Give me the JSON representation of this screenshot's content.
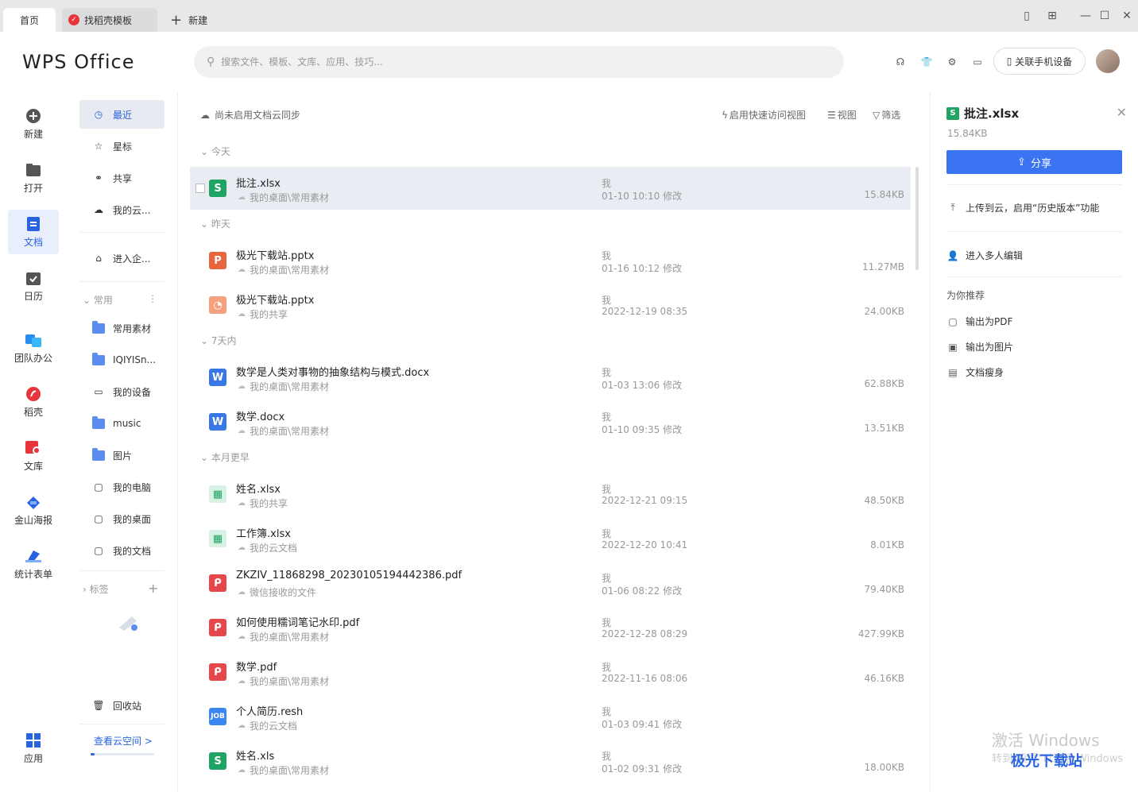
{
  "tabs": {
    "home": "首页",
    "template": "找稻壳模板",
    "new": "新建"
  },
  "header": {
    "logo": "WPS Office",
    "search_placeholder": "搜索文件、模板、文库、应用、技巧...",
    "phone_button": "关联手机设备"
  },
  "leftnav": {
    "new": "新建",
    "open": "打开",
    "docs": "文档",
    "calendar": "日历",
    "team": "团队办公",
    "daoke": "稻壳",
    "library": "文库",
    "poster": "金山海报",
    "forms": "统计表单",
    "apps": "应用"
  },
  "sidebar": {
    "recent": "最近",
    "star": "星标",
    "shared": "共享",
    "mycloud": "我的云...",
    "enterprise": "进入企...",
    "common_section": "常用",
    "items": [
      "常用素材",
      "IQIYISn...",
      "我的设备",
      "music",
      "图片",
      "我的电脑",
      "我的桌面",
      "我的文档"
    ],
    "tags_section": "标签",
    "recycle": "回收站",
    "cloud_link": "查看云空间 >",
    "cloud_usage": 0.06
  },
  "toolbar": {
    "sync_status": "尚未启用文档云同步",
    "quick_view": "启用快速访问视图",
    "view": "视图",
    "filter": "筛选"
  },
  "groups": {
    "today": "今天",
    "yesterday": "昨天",
    "week": "7天内",
    "earlier": "本月更早"
  },
  "files": [
    {
      "name": "批注.xlsx",
      "path": "我的桌面\\常用素材",
      "owner": "我",
      "time": "01-10 10:10 修改",
      "size": "15.84KB"
    },
    {
      "name": "极光下载站.pptx",
      "path": "我的桌面\\常用素材",
      "owner": "我",
      "time": "01-16 10:12 修改",
      "size": "11.27MB"
    },
    {
      "name": "极光下载站.pptx",
      "path": "我的共享",
      "owner": "我",
      "time": "2022-12-19 08:35",
      "size": "24.00KB"
    },
    {
      "name": "数学是人类对事物的抽象结构与模式.docx",
      "path": "我的桌面\\常用素材",
      "owner": "我",
      "time": "01-03 13:06 修改",
      "size": "62.88KB"
    },
    {
      "name": "数学.docx",
      "path": "我的桌面\\常用素材",
      "owner": "我",
      "time": "01-10 09:35 修改",
      "size": "13.51KB"
    },
    {
      "name": "姓名.xlsx",
      "path": "我的共享",
      "owner": "我",
      "time": "2022-12-21 09:15",
      "size": "48.50KB"
    },
    {
      "name": "工作簿.xlsx",
      "path": "我的云文档",
      "owner": "我",
      "time": "2022-12-20 10:41",
      "size": "8.01KB"
    },
    {
      "name": "ZKZIV_11868298_20230105194442386.pdf",
      "path": "微信接收的文件",
      "owner": "我",
      "time": "01-06 08:22 修改",
      "size": "79.40KB"
    },
    {
      "name": "如何使用糯词笔记水印.pdf",
      "path": "我的桌面\\常用素材",
      "owner": "我",
      "time": "2022-12-28 08:29",
      "size": "427.99KB"
    },
    {
      "name": "数学.pdf",
      "path": "我的桌面\\常用素材",
      "owner": "我",
      "time": "2022-11-16 08:06",
      "size": "46.16KB"
    },
    {
      "name": "个人简历.resh",
      "path": "我的云文档",
      "owner": "我",
      "time": "01-03 09:41 修改",
      "size": ""
    },
    {
      "name": "姓名.xls",
      "path": "我的桌面\\常用素材",
      "owner": "我",
      "time": "01-02 09:31 修改",
      "size": "18.00KB"
    }
  ],
  "rpanel": {
    "title": "批注.xlsx",
    "size": "15.84KB",
    "share": "分享",
    "upload": "上传到云，启用“历史版本”功能",
    "multi_edit": "进入多人编辑",
    "recommend": "为你推荐",
    "to_pdf": "输出为PDF",
    "to_image": "输出为图片",
    "slim": "文档瘦身"
  },
  "watermark": {
    "line1": "激活 Windows",
    "line2": "转到\"设置\"以激活 Windows",
    "site": "极光下载站"
  }
}
